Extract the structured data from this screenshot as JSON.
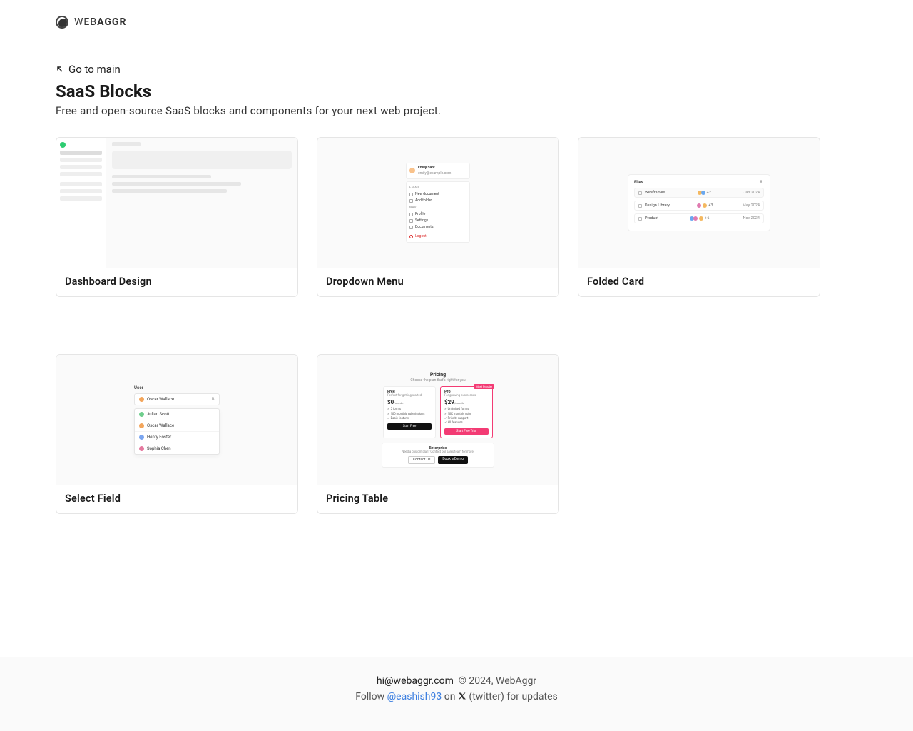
{
  "brand": {
    "pre": "WEB",
    "post": "AGGR"
  },
  "back_link": "Go to main",
  "title": "SaaS Blocks",
  "subtitle": "Free and open-source SaaS blocks and components for your next web project.",
  "cards": {
    "dashboard": {
      "caption": "Dashboard Design"
    },
    "dropdown": {
      "caption": "Dropdown Menu"
    },
    "folded": {
      "caption": "Folded Card"
    },
    "select": {
      "caption": "Select Field"
    },
    "pricing": {
      "caption": "Pricing Table"
    }
  },
  "preview": {
    "dropdown": {
      "name": "Emily Sant",
      "email": "emily@example.com",
      "section_email": "Email",
      "row_new": "New document",
      "row_folder": "Add folder",
      "section_nav": "Nav",
      "row_profile": "Profile",
      "row_settings": "Settings",
      "row_docs": "Documents",
      "logout": "Logout"
    },
    "files": {
      "title": "Files",
      "rows": [
        {
          "name": "Wireframes",
          "extra": "+2",
          "date": "Jan 2024"
        },
        {
          "name": "Design Library",
          "extra": "+3",
          "date": "May 2024"
        },
        {
          "name": "Product",
          "extra": "+6",
          "date": "Nov 2024"
        }
      ]
    },
    "select": {
      "label": "User",
      "selected": "Oscar Wallace",
      "options": [
        "Julian Scott",
        "Oscar Wallace",
        "Henry Foster",
        "Sophia Chen"
      ]
    },
    "pricing": {
      "title": "Pricing",
      "subtitle": "Choose the plan that's right for you",
      "free": {
        "name": "Free",
        "tag": "Perfect for getting started",
        "price": "$0",
        "per": "/month",
        "features": [
          "5 forms",
          "100 monthly submissions",
          "Basic features"
        ],
        "button": "Start Free"
      },
      "pro": {
        "name": "Pro",
        "badge": "Most Popular",
        "tag": "For growing businesses",
        "price": "$29",
        "per": "/month",
        "features": [
          "Unlimited forms",
          "10K monthly subs",
          "Priority support",
          "All features"
        ],
        "button": "Start Free Trial"
      },
      "enterprise": {
        "name": "Enterprise",
        "tag": "Need a custom plan? Contact our sales team for more.",
        "button_contact": "Contact Us",
        "button_demo": "Book a Demo"
      }
    }
  },
  "footer": {
    "email": "hi@webaggr.com",
    "copyright": "© 2024, WebAggr",
    "follow_pre": "Follow",
    "handle": "@eashish93",
    "follow_post_on": "on",
    "follow_post_tail": "(twitter) for updates"
  }
}
